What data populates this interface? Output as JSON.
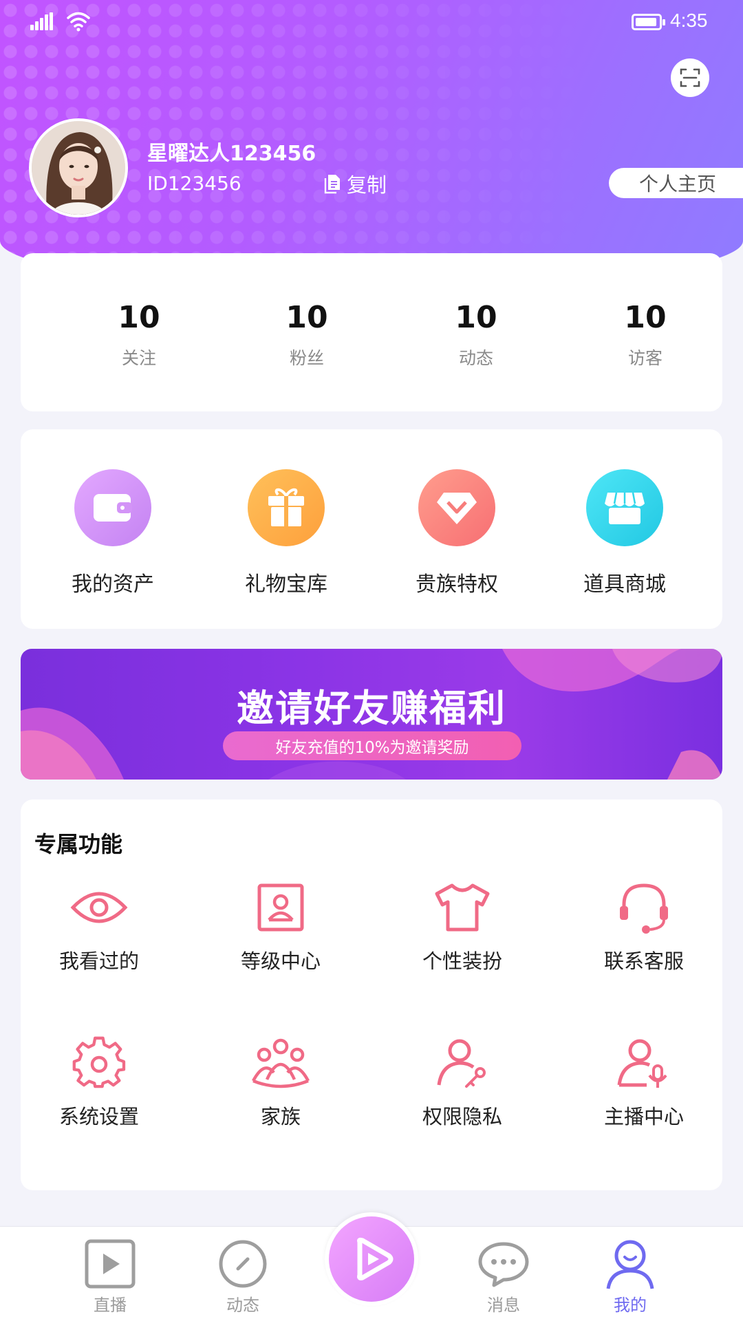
{
  "status_bar": {
    "time": "4:35"
  },
  "profile": {
    "username": "星曜达人123456",
    "user_id": "ID123456",
    "copy_label": "复制",
    "homepage_label": "个人主页"
  },
  "stats": [
    {
      "value": "10",
      "label": "关注"
    },
    {
      "value": "10",
      "label": "粉丝"
    },
    {
      "value": "10",
      "label": "动态"
    },
    {
      "value": "10",
      "label": "访客"
    }
  ],
  "assets": [
    {
      "label": "我的资产",
      "icon": "wallet-icon",
      "color": "#c98bf5"
    },
    {
      "label": "礼物宝库",
      "icon": "gift-icon",
      "color": "#fdb04c"
    },
    {
      "label": "贵族特权",
      "icon": "diamond-icon",
      "color": "#fa7f7a"
    },
    {
      "label": "道具商城",
      "icon": "store-icon",
      "color": "#2fd7ea"
    }
  ],
  "banner": {
    "title": "邀请好友赚福利",
    "subtitle": "好友充值的10%为邀请奖励"
  },
  "features": {
    "title": "专属功能",
    "items": [
      {
        "label": "我看过的",
        "icon": "eye-icon"
      },
      {
        "label": "等级中心",
        "icon": "profile-card-icon"
      },
      {
        "label": "个性装扮",
        "icon": "tshirt-icon"
      },
      {
        "label": "联系客服",
        "icon": "headset-icon"
      },
      {
        "label": "系统设置",
        "icon": "gear-icon"
      },
      {
        "label": "家族",
        "icon": "group-icon"
      },
      {
        "label": "权限隐私",
        "icon": "user-key-icon"
      },
      {
        "label": "主播中心",
        "icon": "user-mic-icon"
      }
    ],
    "accent_color": "#f06a86"
  },
  "bottom_nav": [
    {
      "label": "直播",
      "icon": "live-play-icon"
    },
    {
      "label": "动态",
      "icon": "compass-icon"
    },
    {
      "label": "消息",
      "icon": "chat-bubble-icon"
    },
    {
      "label": "我的",
      "icon": "smiley-user-icon",
      "active": true
    }
  ],
  "colors": {
    "header_start": "#c254ff",
    "header_end": "#8f7cff",
    "nav_active": "#6f6af0"
  }
}
